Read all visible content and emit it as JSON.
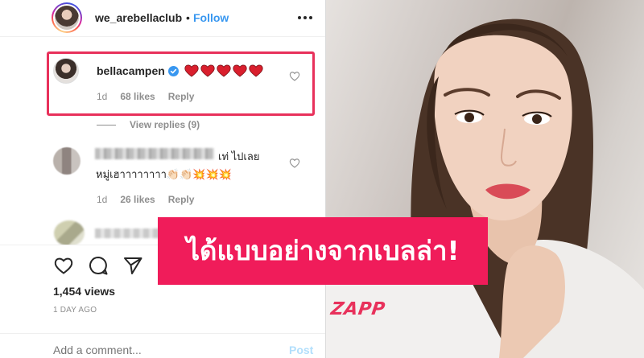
{
  "post_header": {
    "username": "we_arebellaclub",
    "separator": "•",
    "follow_label": "Follow",
    "more_icon": "more-options-icon"
  },
  "comments": [
    {
      "username": "bellacampen",
      "verified": true,
      "text_emoji": "red-heart x5",
      "age": "1d",
      "likes": "68 likes",
      "reply_label": "Reply",
      "highlight_color": "#e8315b"
    },
    {
      "username": "",
      "text_line1": "เท่ ไปเลย",
      "text_line2": "หมู่เฮาาาาาาาา👏🏻👏🏻💥💥💥",
      "age": "1d",
      "likes": "26 likes",
      "reply_label": "Reply"
    },
    {
      "username": ""
    }
  ],
  "view_replies": "View replies (9)",
  "actions": {
    "views": "1,454 views",
    "posted_ago": "1 DAY AGO",
    "icons": [
      "heart-outline-icon",
      "comment-icon",
      "share-icon"
    ]
  },
  "add_comment": {
    "placeholder": "Add a comment...",
    "post_label": "Post"
  },
  "banner": {
    "text": "ได้แบบอย่างจากเบลล่า!",
    "color": "#f01c5a"
  },
  "photo_watermark": "ZAPP",
  "colors": {
    "link_blue": "#3897f0",
    "muted": "#8e8e8e",
    "post_disabled": "#b2dffc"
  }
}
